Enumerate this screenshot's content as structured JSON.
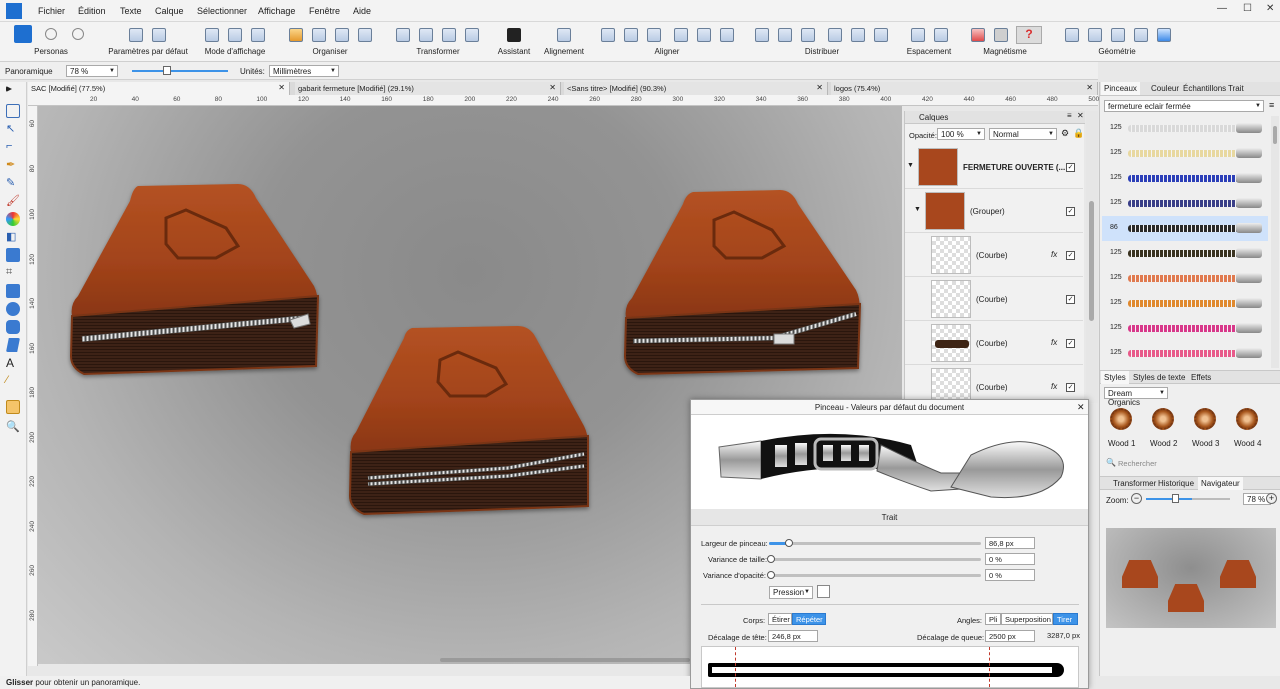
{
  "menu": [
    "Fichier",
    "Édition",
    "Texte",
    "Calque",
    "Sélectionner",
    "Affichage",
    "Fenêtre",
    "Aide"
  ],
  "toolbar": {
    "personas": "Personas",
    "defaults": "Paramètres par défaut",
    "view_mode": "Mode d'affichage",
    "arrange": "Organiser",
    "transform": "Transformer",
    "assistant": "Assistant",
    "alignment": "Alignement",
    "align": "Aligner",
    "distribute": "Distribuer",
    "spacing": "Espacement",
    "snapping": "Magnétisme",
    "geometry": "Géométrie"
  },
  "context": {
    "tool": "Panoramique",
    "zoom": "78 %",
    "units_label": "Unités:",
    "units": "Millimètres"
  },
  "tabs": [
    "SAC [Modifié] (77.5%)",
    "gabarit fermeture [Modifié] (29.1%)",
    "<Sans titre> [Modifié] (90.3%)",
    "logos (75.4%)"
  ],
  "ruler_h": [
    "20",
    "40",
    "60",
    "80",
    "100",
    "120",
    "140",
    "160",
    "180",
    "200",
    "220",
    "240",
    "260",
    "280",
    "300",
    "320",
    "340",
    "360",
    "380",
    "400",
    "420",
    "440",
    "460",
    "480",
    "500"
  ],
  "ruler_v": [
    "60",
    "80",
    "100",
    "120",
    "140",
    "160",
    "180",
    "200",
    "220",
    "240",
    "260",
    "280"
  ],
  "layers": {
    "title": "Calques",
    "opacity_label": "Opacité:",
    "opacity": "100 %",
    "blend": "Normal",
    "rows": [
      {
        "name": "FERMETURE OUVERTE (...",
        "fx": ""
      },
      {
        "name": "(Grouper)",
        "fx": ""
      },
      {
        "name": "(Courbe)",
        "fx": "fx"
      },
      {
        "name": "(Courbe)",
        "fx": ""
      },
      {
        "name": "(Courbe)",
        "fx": "fx"
      },
      {
        "name": "(Courbe)",
        "fx": "fx"
      }
    ]
  },
  "dialog": {
    "title": "Pinceau - Valeurs par défaut du document",
    "section": "Trait",
    "width_label": "Largeur de pinceau:",
    "width_value": "86,8 px",
    "size_var_label": "Variance de taille:",
    "size_var_value": "0 %",
    "opacity_var_label": "Variance d'opacité:",
    "opacity_var_value": "0 %",
    "pressure": "Pression",
    "body_label": "Corps:",
    "body_stretch": "Étirer",
    "body_repeat": "Répéter",
    "angles_label": "Angles:",
    "angle_fold": "Pli",
    "angle_overlap": "Superposition",
    "angle_pull": "Tirer",
    "head_offset_label": "Décalage de tête:",
    "head_offset_value": "246,8 px",
    "tail_offset_label": "Décalage de queue:",
    "tail_offset_value": "2500 px",
    "total_length": "3287,0 px"
  },
  "right_panel": {
    "tabs": [
      "Pinceaux",
      "Couleur",
      "Échantillons",
      "Trait"
    ],
    "category": "fermeture eclair fermée",
    "brushes": [
      {
        "n": "125",
        "color": "#d9d9d9"
      },
      {
        "n": "125",
        "color": "#e8d8a0"
      },
      {
        "n": "125",
        "color": "#2c3fb8"
      },
      {
        "n": "125",
        "color": "#3a3f88"
      },
      {
        "n": "86",
        "color": "#2a2a2a"
      },
      {
        "n": "125",
        "color": "#3a3320"
      },
      {
        "n": "125",
        "color": "#e07a4f"
      },
      {
        "n": "125",
        "color": "#e0892e"
      },
      {
        "n": "125",
        "color": "#d8388a"
      },
      {
        "n": "125",
        "color": "#e85a8a"
      }
    ],
    "styles_tabs": [
      "Styles",
      "Styles de texte",
      "Effets"
    ],
    "styles_category": "Dream Organics",
    "styles": [
      "Wood 1",
      "Wood 2",
      "Wood 3",
      "Wood 4"
    ],
    "search_placeholder": "Rechercher",
    "nav_tabs": [
      "Transformer",
      "Historique",
      "Navigateur"
    ],
    "zoom_label": "Zoom:",
    "zoom_value": "78 %"
  },
  "status": {
    "bold": "Glisser",
    "text": " pour obtenir un panoramique."
  },
  "colors": {
    "accent": "#3d93e8",
    "leather": "#a8471d",
    "zipper_band": "#3d2414"
  }
}
